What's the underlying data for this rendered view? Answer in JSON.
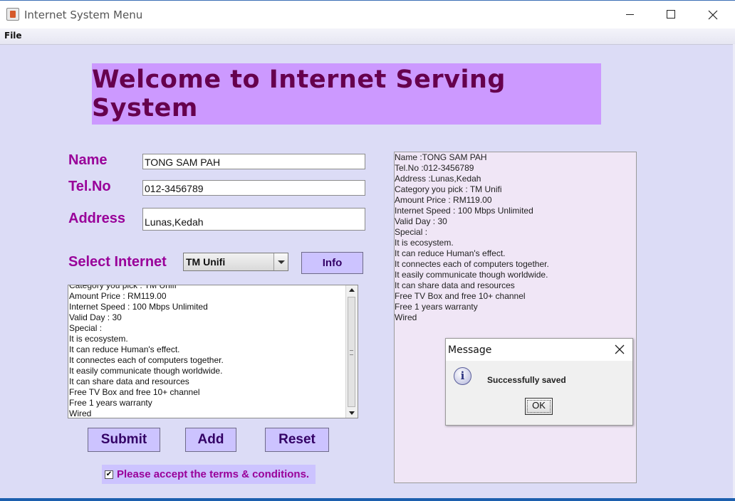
{
  "window": {
    "title": "Internet System Menu"
  },
  "menu": {
    "file": "File"
  },
  "banner": {
    "title": "Welcome to Internet Serving System"
  },
  "form": {
    "name_label": "Name",
    "name_value": "TONG SAM PAH",
    "tel_label": "Tel.No",
    "tel_value": "012-3456789",
    "address_label": "Address",
    "address_value": "Lunas,Kedah",
    "select_label": "Select Internet",
    "select_value": "TM Unifi",
    "info_button": "Info"
  },
  "details_text": "Category you pick : TM Unifi\nAmount Price : RM119.00\nInternet Speed : 100 Mbps Unlimited\nValid Day : 30\nSpecial :\nIt is ecosystem.\nIt can reduce Human's effect.\nIt connectes each of computers together.\nIt easily communicate though worldwide.\nIt can share data and resources\nFree TV Box and free 10+ channel\nFree 1 years warranty\nWired",
  "buttons": {
    "submit": "Submit",
    "add": "Add",
    "reset": "Reset"
  },
  "terms": {
    "checked": true,
    "label": "Please accept the terms & conditions."
  },
  "output_text": "Name :TONG SAM PAH\nTel.No :012-3456789\nAddress :Lunas,Kedah\nCategory you pick : TM Unifi\nAmount Price : RM119.00\nInternet Speed : 100 Mbps Unlimited\nValid Day : 30\nSpecial :\nIt is ecosystem.\nIt can reduce Human's effect.\nIt connectes each of computers together.\nIt easily communicate though worldwide.\nIt can share data and resources\nFree TV Box and free 10+ channel\nFree 1 years warranty\nWired",
  "dialog": {
    "title": "Message",
    "message": "Successfully saved",
    "ok": "OK",
    "icon": "info-icon"
  },
  "colors": {
    "background": "#dcdcf6",
    "banner": "#cc99ff",
    "banner_text": "#66004d",
    "label": "#990099",
    "button": "#ccc3ff",
    "output_panel": "#f0e6f6"
  }
}
